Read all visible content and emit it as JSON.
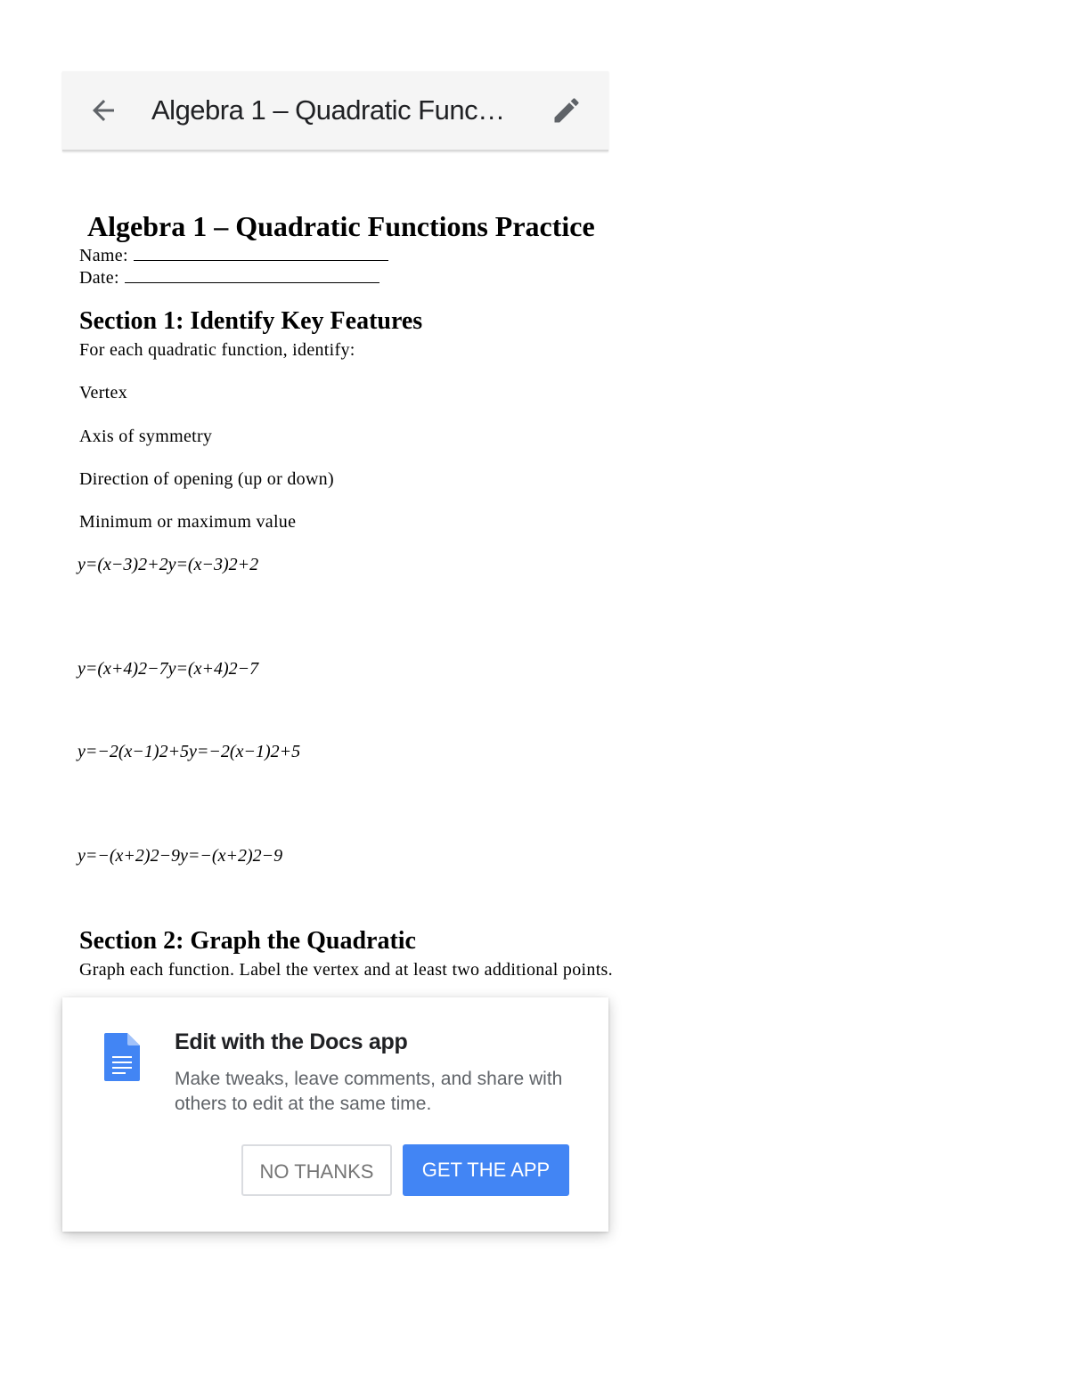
{
  "appbar": {
    "title": "Algebra 1 – Quadratic Func…",
    "back_icon": "arrow-back-icon",
    "edit_icon": "pencil-icon"
  },
  "document": {
    "title": "Algebra 1 – Quadratic Functions Practice",
    "name_label": "Name:",
    "date_label": "Date:",
    "section1": {
      "heading": "Section 1: Identify Key Features",
      "intro": "For each quadratic function, identify:",
      "items": [
        "Vertex",
        "Axis of symmetry",
        "Direction of opening (up or down)",
        "Minimum or maximum value"
      ],
      "equations": [
        "y=(x−3)2+2y=(x−3)2+2",
        "y=(x+4)2−7y=(x+4)2−7",
        "y=−2(x−1)2+5y=−2(x−1)2+5",
        "y=−(x+2)2−9y=−(x+2)2−9"
      ]
    },
    "section2": {
      "heading": "Section 2: Graph the Quadratic",
      "intro": "Graph each function. Label the vertex and at least two additional points."
    }
  },
  "promo": {
    "icon": "docs-app-icon",
    "title": "Edit with the Docs app",
    "body": "Make tweaks, leave comments, and share with others to edit at the same time.",
    "no_thanks_label": "NO THANKS",
    "get_app_label": "GET THE APP",
    "accent_color": "#4285f4"
  }
}
